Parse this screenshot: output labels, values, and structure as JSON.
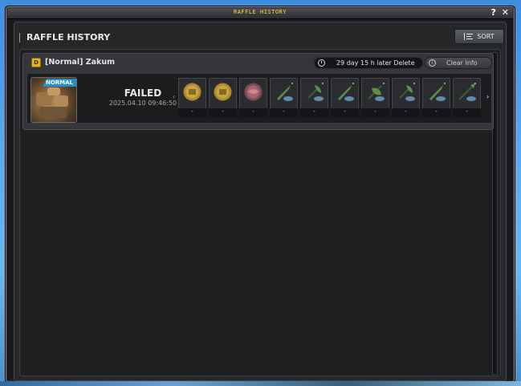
{
  "window": {
    "title": "RAFFLE HISTORY",
    "help_label": "?",
    "close_label": "✕"
  },
  "header": {
    "title": "RAFFLE HISTORY",
    "sort_label": "SORT",
    "sort_icon": "sort-lines-icon"
  },
  "entry": {
    "boss_name": "[Normal] Zakum",
    "boss_badge": "D",
    "delete_text": "29 day 15 h later Delete",
    "clear_label": "Clear Info",
    "clear_icon_text": "i",
    "difficulty_tag": "NORMAL",
    "status": "FAILED",
    "date": "2025.04.10 09:46:50",
    "rewards": [
      {
        "icon": "gold-coin-icon",
        "qty": "-"
      },
      {
        "icon": "gold-coin-icon",
        "qty": "-"
      },
      {
        "icon": "pink-orb-icon",
        "qty": "-"
      },
      {
        "icon": "green-sword-icon",
        "qty": "-"
      },
      {
        "icon": "green-axe-icon",
        "qty": "-"
      },
      {
        "icon": "green-sword-icon",
        "qty": "-"
      },
      {
        "icon": "green-leaf-weapon-icon",
        "qty": "-"
      },
      {
        "icon": "green-axe-icon",
        "qty": "-"
      },
      {
        "icon": "green-sword-icon",
        "qty": "-"
      },
      {
        "icon": "green-spear-icon",
        "qty": "-"
      }
    ]
  },
  "colors": {
    "accent_gold": "#ffd84a",
    "badge_blue": "#2a8fc8",
    "panel_dark": "#1a1b1d"
  }
}
